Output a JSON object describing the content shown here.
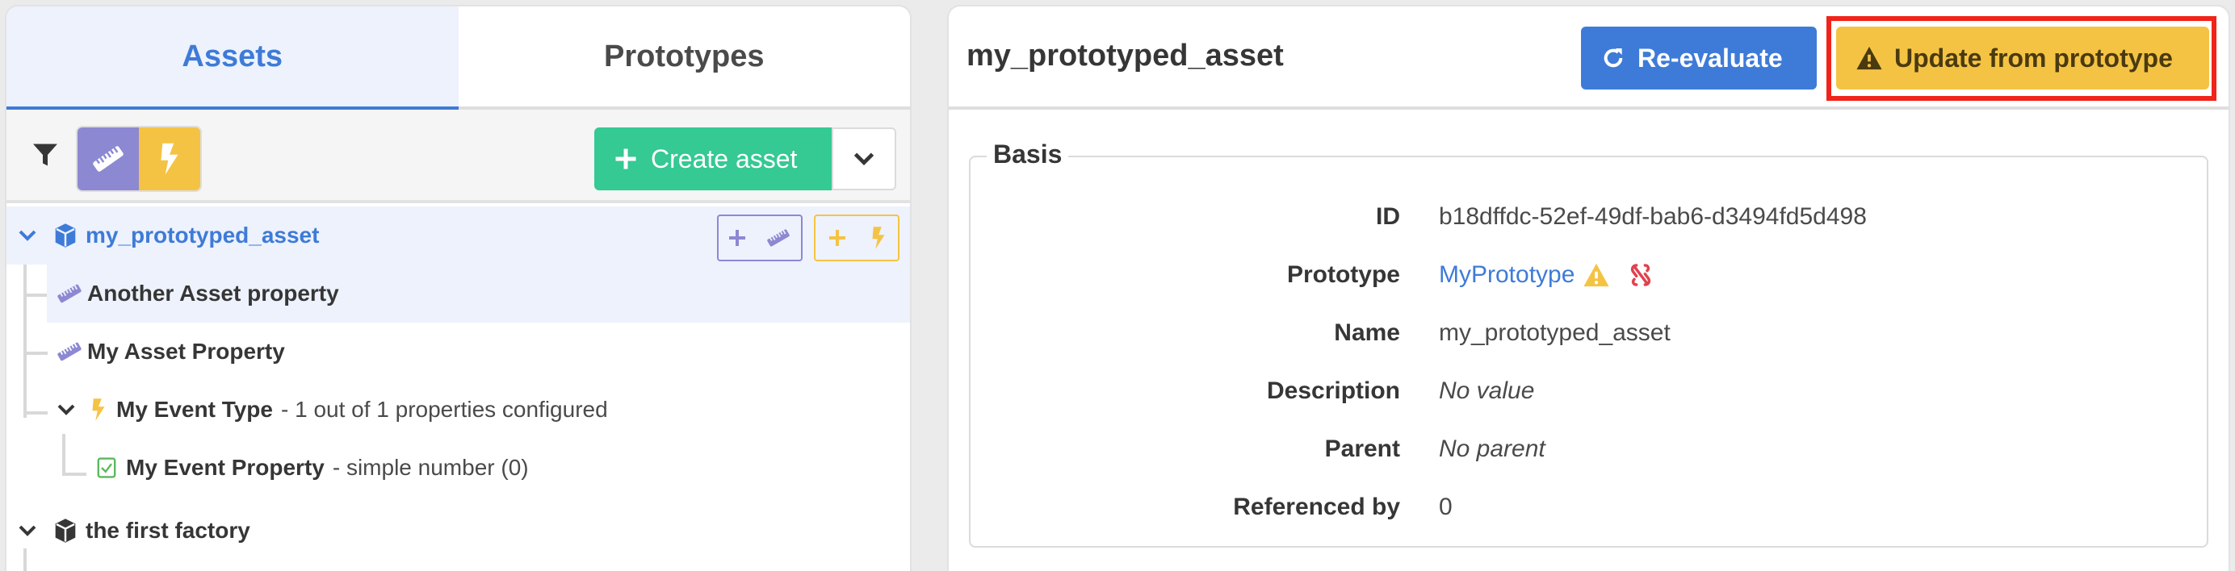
{
  "left": {
    "tabs": [
      {
        "label": "Assets",
        "active": true
      },
      {
        "label": "Prototypes",
        "active": false
      }
    ],
    "toolbar": {
      "filter_icon": "filter-icon",
      "toggles": [
        {
          "icon": "ruler-icon",
          "color": "#8d88d2"
        },
        {
          "icon": "bolt-icon",
          "color": "#f5c344"
        }
      ],
      "create_label": "Create asset"
    },
    "tree": [
      {
        "level": 0,
        "label": "my_prototyped_asset",
        "icon": "cube-icon",
        "expanded": true,
        "selected": true
      },
      {
        "level": 1,
        "label": "Another Asset property",
        "icon": "ruler-icon"
      },
      {
        "level": 1,
        "label": "My Asset Property",
        "icon": "ruler-icon"
      },
      {
        "level": 1,
        "label": "My Event Type",
        "meta": "- 1 out of 1 properties configured",
        "icon": "bolt-icon",
        "expanded": true
      },
      {
        "level": 2,
        "label": "My Event Property",
        "meta": "- simple number (0)",
        "icon": "check-square-icon"
      },
      {
        "level": 0,
        "label": "the first factory",
        "icon": "cube-icon",
        "expanded": true
      }
    ]
  },
  "right": {
    "title": "my_prototyped_asset",
    "reevaluate_label": "Re-evaluate",
    "update_label": "Update from prototype",
    "basis": {
      "legend": "Basis",
      "rows": [
        {
          "label": "ID",
          "value": "b18dffdc-52ef-49df-bab6-d3494fd5d498"
        },
        {
          "label": "Prototype",
          "value": "MyPrototype"
        },
        {
          "label": "Name",
          "value": "my_prototyped_asset"
        },
        {
          "label": "Description",
          "value": "No value"
        },
        {
          "label": "Parent",
          "value": "No parent"
        },
        {
          "label": "Referenced by",
          "value": "0"
        }
      ]
    }
  },
  "colors": {
    "primary": "#3e7bd8",
    "success": "#35c994",
    "warning": "#f5c344",
    "property": "#8d88d2",
    "danger": "#e0424f",
    "highlight": "#f0241a"
  }
}
